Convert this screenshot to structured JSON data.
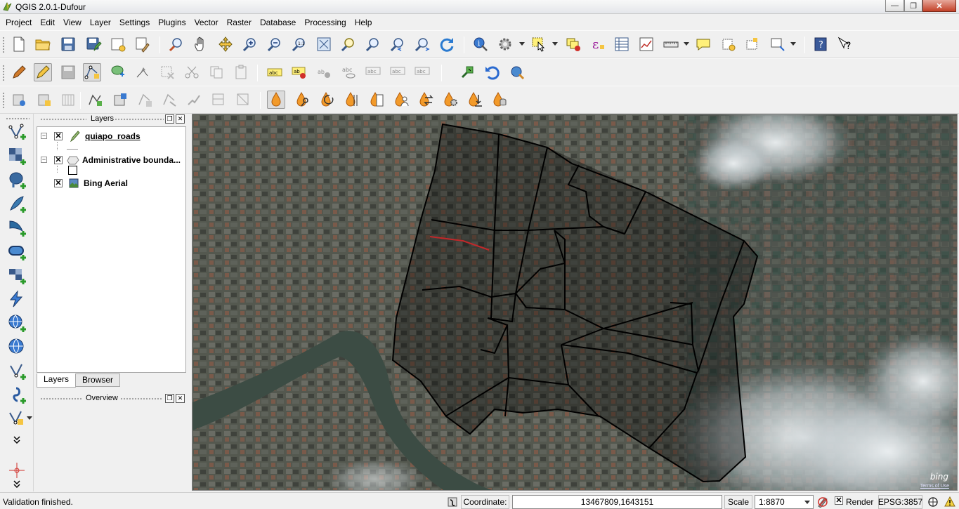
{
  "window": {
    "title": "QGIS 2.0.1-Dufour",
    "min_label": "—",
    "max_label": "❐",
    "close_label": "✕"
  },
  "menubar": {
    "items": [
      "Project",
      "Edit",
      "View",
      "Layer",
      "Settings",
      "Plugins",
      "Vector",
      "Raster",
      "Database",
      "Processing",
      "Help"
    ]
  },
  "layers_panel": {
    "title": "Layers",
    "float_label": "❐",
    "close_label": "✕",
    "layers": [
      {
        "name": "quiapo_roads",
        "checked": "✕",
        "expander": "−",
        "type": "line-layer-icon"
      },
      {
        "name": "Administrative bounda...",
        "checked": "✕",
        "expander": "−",
        "type": "polygon-layer-icon"
      },
      {
        "name": "Bing Aerial",
        "checked": "✕",
        "type": "raster-layer-icon"
      }
    ],
    "tabs": [
      "Layers",
      "Browser"
    ]
  },
  "overview_panel": {
    "title": "Overview",
    "float_label": "❐",
    "close_label": "✕"
  },
  "map": {
    "attribution_logo": "bing",
    "attribution_terms": "Terms of Use",
    "boundary_color": "#000000",
    "road_color": "#c0282a"
  },
  "statusbar": {
    "message": "Validation finished.",
    "coordinate_label": "Coordinate:",
    "coordinate_value": "13467809,1643151",
    "scale_label": "Scale",
    "scale_value": "1:8870",
    "render_label": "Render",
    "render_checked": "✕",
    "crs_label": "EPSG:3857"
  },
  "left_toolbar": {
    "more_label": "»"
  }
}
